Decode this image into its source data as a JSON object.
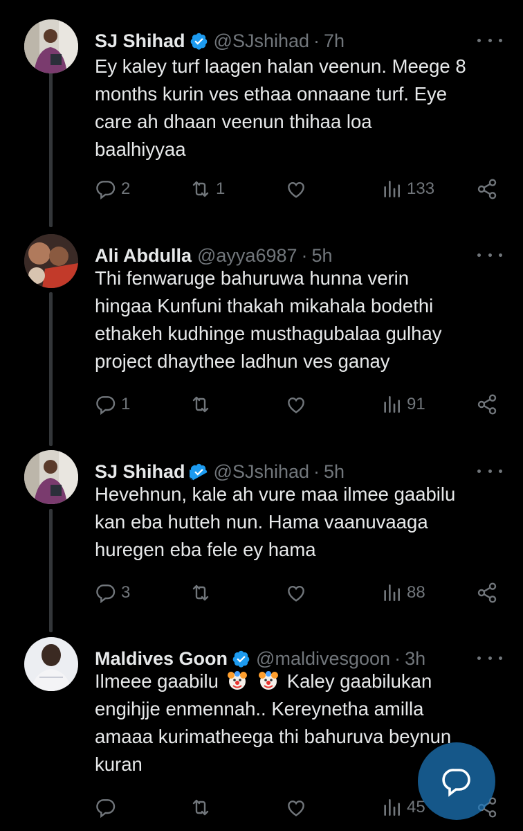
{
  "colors": {
    "background": "#000000",
    "text": "#e7e9ea",
    "muted": "#71767b",
    "verified": "#1d9bf0",
    "accent": "#1d9bf0"
  },
  "tweets": [
    {
      "name": "SJ Shihad",
      "verified": true,
      "handle": "@SJshihad",
      "time": "7h",
      "lines": [
        "Ey kaley turf laagen halan veenun. Meege 8",
        "months kurin ves ethaa onnaane turf. Eye",
        "care ah dhaan veenun thihaa loa",
        "baalhiyyaa"
      ],
      "replies": "2",
      "retweets": "1",
      "likes": "",
      "views": "133"
    },
    {
      "name": "Ali Abdulla",
      "verified": false,
      "handle": "@ayya6987",
      "time": "5h",
      "lines": [
        "Thi fenwaruge bahuruwa hunna verin",
        "hingaa Kunfuni thakah mikahala bodethi",
        "ethakeh kudhinge musthagubalaa gulhay",
        "project dhaythee ladhun ves ganay"
      ],
      "replies": "1",
      "retweets": "",
      "likes": "",
      "views": "91"
    },
    {
      "name": "SJ Shihad",
      "verified": true,
      "handle": "@SJshihad",
      "time": "5h",
      "lines": [
        "Hevehnun, kale ah vure maa ilmee gaabilu",
        "kan eba hutteh nun. Hama vaanuvaaga",
        "huregen eba fele ey hama"
      ],
      "replies": "3",
      "retweets": "",
      "likes": "",
      "views": "88"
    },
    {
      "name": "Maldives Goon",
      "verified": true,
      "handle": "@maldivesgoon",
      "time": "3h",
      "line1_before": "Ilmeee gaabilu",
      "line1_after": "Kaley gaabilukan",
      "lines_rest": [
        "engihjje enmennah.. Kereynetha amilla",
        "amaaa kurimatheega thi bahuruva beynun",
        "kuran"
      ],
      "emoji": [
        "clown-face",
        "clown-face"
      ],
      "replies": "",
      "retweets": "",
      "likes": "",
      "views": "45"
    }
  ],
  "fab_icon": "compose-reply-icon"
}
